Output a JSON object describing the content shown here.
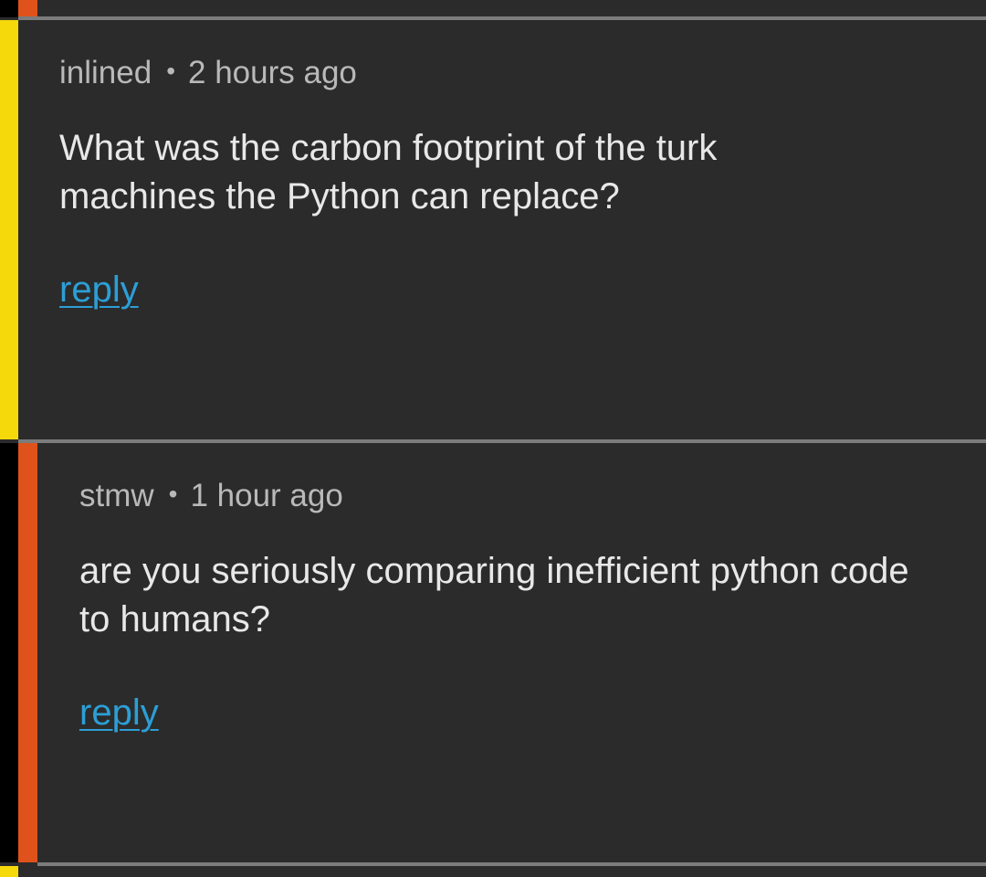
{
  "thread": {
    "comments": [
      {
        "author": "inlined",
        "separator": "•",
        "time": "2 hours ago",
        "text": "What was the carbon footprint of the turk machines the Python can replace?",
        "reply_label": "reply",
        "depth_colors": [
          "#f5d90a"
        ]
      },
      {
        "author": "stmw",
        "separator": "•",
        "time": "1 hour ago",
        "text": "are you seriously comparing inefficient python code to humans?",
        "reply_label": "reply",
        "depth_colors": [
          "#000000",
          "#e0521b"
        ]
      }
    ]
  },
  "colors": {
    "background": "#2b2b2b",
    "divider": "#7c7c7c",
    "meta_text": "#b9b9b9",
    "body_text": "#e8e8e8",
    "link": "#2c9fd6",
    "depth_yellow": "#f5d90a",
    "depth_orange": "#e0521b",
    "depth_black": "#000000"
  }
}
